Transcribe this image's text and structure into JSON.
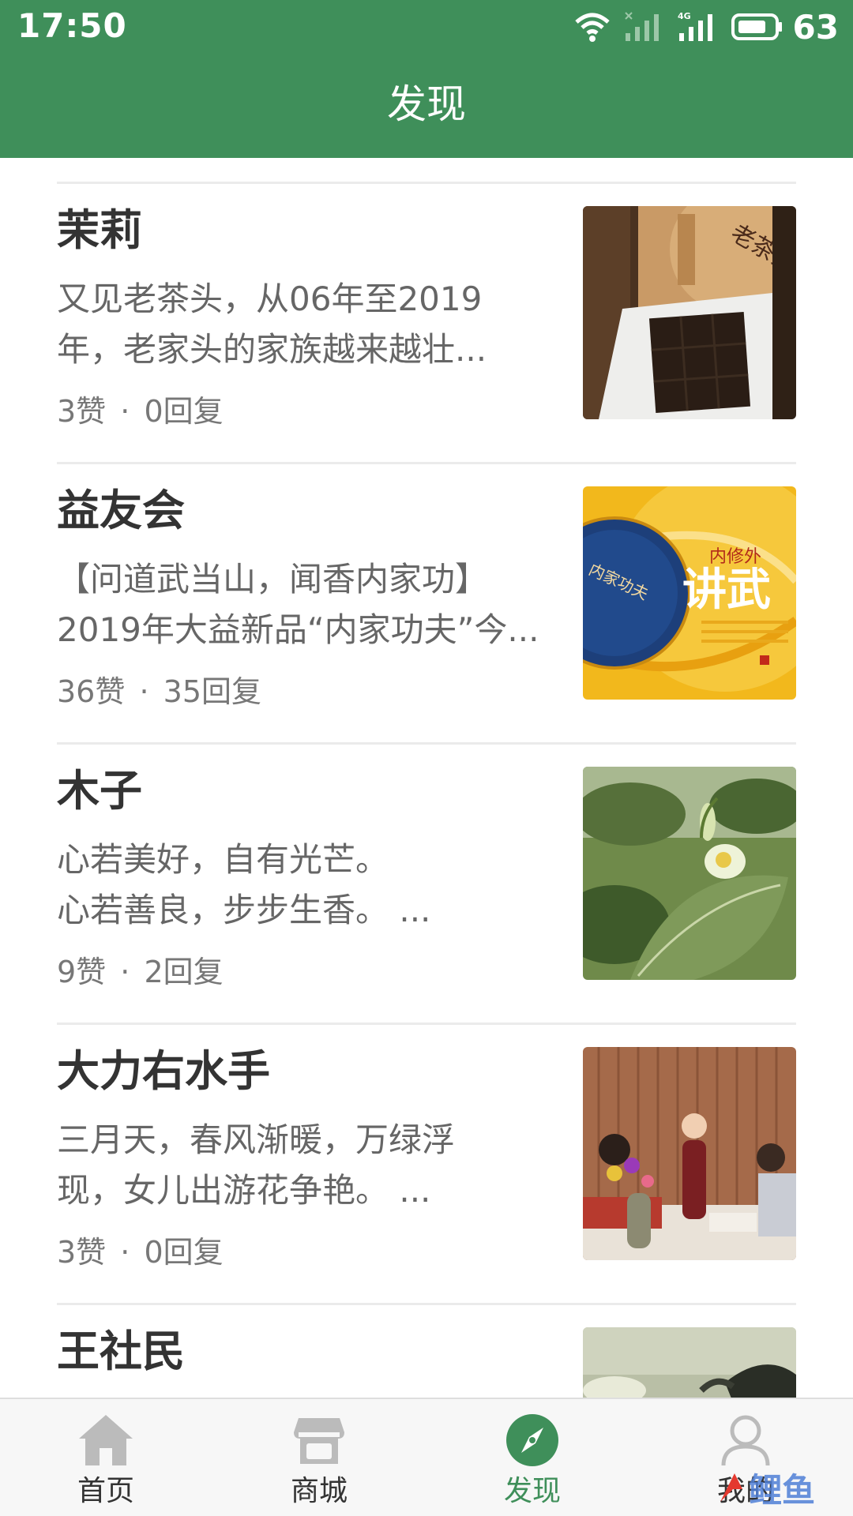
{
  "status_bar": {
    "time": "17:50",
    "battery_level": "63",
    "network_label": "4G",
    "icons": [
      "wifi-icon",
      "signal-sim1-icon",
      "signal-4g-icon",
      "battery-icon"
    ]
  },
  "header": {
    "title": "发现",
    "background_color": "#3f8f5a"
  },
  "posts": [
    {
      "author": "茉莉",
      "excerpt": [
        "又见老茶头，从06年至2019",
        "年，老家头的家族越来越壮..."
      ],
      "likes": "3赞",
      "separator": "·",
      "replies": "0回复",
      "thumbnail": "tea-brick-photo"
    },
    {
      "author": "益友会",
      "excerpt": [
        "【问道武当山，闻香内家功】",
        "2019年大益新品“内家功夫”今..."
      ],
      "likes": "36赞",
      "separator": "·",
      "replies": "35回复",
      "thumbnail": "tea-cake-promo-poster",
      "thumbnail_text": {
        "top": "内修外",
        "main": "讲武",
        "cake": "内家功夫"
      }
    },
    {
      "author": "木子",
      "excerpt": [
        "心若美好，自有光芒。",
        "心若善良，步步生香。 ..."
      ],
      "likes": "9赞",
      "separator": "·",
      "replies": "2回复",
      "thumbnail": "tea-flower-photo"
    },
    {
      "author": "大力右水手",
      "excerpt": [
        "三月天，春风渐暖，万绿浮",
        "现，女儿出游花争艳。 ..."
      ],
      "likes": "3赞",
      "separator": "·",
      "replies": "0回复",
      "thumbnail": "tea-event-photo"
    },
    {
      "author": "王社民",
      "excerpt": [],
      "thumbnail": "teapot-pouring-photo"
    }
  ],
  "bottom_nav": [
    {
      "label": "首页",
      "icon": "home-icon",
      "active": false
    },
    {
      "label": "商城",
      "icon": "store-icon",
      "active": false
    },
    {
      "label": "发现",
      "icon": "compass-icon",
      "active": true
    },
    {
      "label": "我的",
      "icon": "user-icon",
      "active": false
    }
  ],
  "colors": {
    "accent": "#3f8f5a",
    "author_text": "#333333",
    "excerpt_text": "#666666",
    "stats_text": "#777777",
    "divider": "#ebebeb",
    "inactive_icon": "#bbbbbb"
  },
  "watermark": {
    "text": "鲤鱼",
    "icon": "watermark-logo"
  }
}
